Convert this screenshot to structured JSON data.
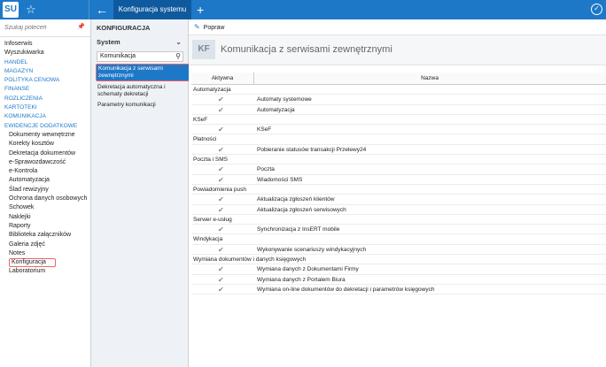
{
  "topbar": {
    "logo": "SU",
    "active_tab": "Konfiguracja systemu"
  },
  "leftnav": {
    "search_placeholder": "Szukaj poleceń",
    "items": [
      {
        "label": "Infoserwis",
        "kind": "plain"
      },
      {
        "label": "Wyszukiwarka",
        "kind": "plain"
      },
      {
        "label": "HANDEL",
        "kind": "section"
      },
      {
        "label": "MAGAZYN",
        "kind": "section"
      },
      {
        "label": "POLITYKA CENOWA",
        "kind": "section"
      },
      {
        "label": "FINANSE",
        "kind": "section"
      },
      {
        "label": "ROZLICZENIA",
        "kind": "section"
      },
      {
        "label": "KARTOTEKI",
        "kind": "section"
      },
      {
        "label": "KOMUNIKACJA",
        "kind": "section"
      },
      {
        "label": "EWIDENCJE DODATKOWE",
        "kind": "section"
      },
      {
        "label": "Dokumenty wewnętrzne",
        "kind": "sub"
      },
      {
        "label": "Korekty kosztów",
        "kind": "sub"
      },
      {
        "label": "Dekretacja dokumentów",
        "kind": "sub"
      },
      {
        "label": "e-Sprawozdawczość",
        "kind": "sub"
      },
      {
        "label": "e-Kontrola",
        "kind": "sub"
      },
      {
        "label": "Automatyzacja",
        "kind": "sub"
      },
      {
        "label": "Ślad rewizyjny",
        "kind": "sub"
      },
      {
        "label": "Ochrona danych osobowych",
        "kind": "sub"
      },
      {
        "label": "Schowek",
        "kind": "sub"
      },
      {
        "label": "Naklejki",
        "kind": "sub"
      },
      {
        "label": "Raporty",
        "kind": "sub"
      },
      {
        "label": "Biblioteka załączników",
        "kind": "sub"
      },
      {
        "label": "Galeria zdjęć",
        "kind": "sub"
      },
      {
        "label": "Notes",
        "kind": "sub"
      },
      {
        "label": "Konfiguracja",
        "kind": "sub-selected"
      },
      {
        "label": "Laboratorium",
        "kind": "sub"
      }
    ]
  },
  "midpanel": {
    "title": "KONFIGURACJA",
    "dropdown": "System",
    "search_value": "Komunikacja",
    "items": [
      {
        "label": "Komunikacja z serwisami zewnętrznymi",
        "active": true
      },
      {
        "label": "Dekretacja automatyczna i schematy dekretacji",
        "active": false
      },
      {
        "label": "Parametry komunikacji",
        "active": false
      }
    ]
  },
  "right": {
    "edit_label": "Popraw",
    "badge": "KF",
    "title": "Komunikacja z serwisami zewnętrznymi",
    "col_active": "Aktywna",
    "col_name": "Nazwa",
    "groups": [
      {
        "name": "Automatyzacja",
        "rows": [
          "Automaty systemowe",
          "Automatyzacja"
        ]
      },
      {
        "name": "KSeF",
        "rows": [
          "KSeF"
        ]
      },
      {
        "name": "Płatności",
        "rows": [
          "Pobieranie statusów transakcji Przelewy24"
        ]
      },
      {
        "name": "Poczta i SMS",
        "rows": [
          "Poczta",
          "Wiadomości SMS"
        ]
      },
      {
        "name": "Powiadomienia push",
        "rows": [
          "Aktualizacja zgłoszeń klientów",
          "Aktualizacja zgłoszeń serwisowych"
        ]
      },
      {
        "name": "Serwer e-usług",
        "rows": [
          "Synchronizacja z InsERT mobile"
        ]
      },
      {
        "name": "Windykacja",
        "rows": [
          "Wykonywanie scenariuszy windykacyjnych"
        ]
      },
      {
        "name": "Wymiana dokumentów i danych księgowych",
        "rows": [
          "Wymiana danych z Dokumentami Firmy",
          "Wymiana danych z Portalem Biura",
          "Wymiana on-line dokumentów do dekretacji i parametrów księgowych"
        ]
      }
    ]
  },
  "colors": {
    "accent": "#1e78c8",
    "highlight": "#e66666"
  }
}
